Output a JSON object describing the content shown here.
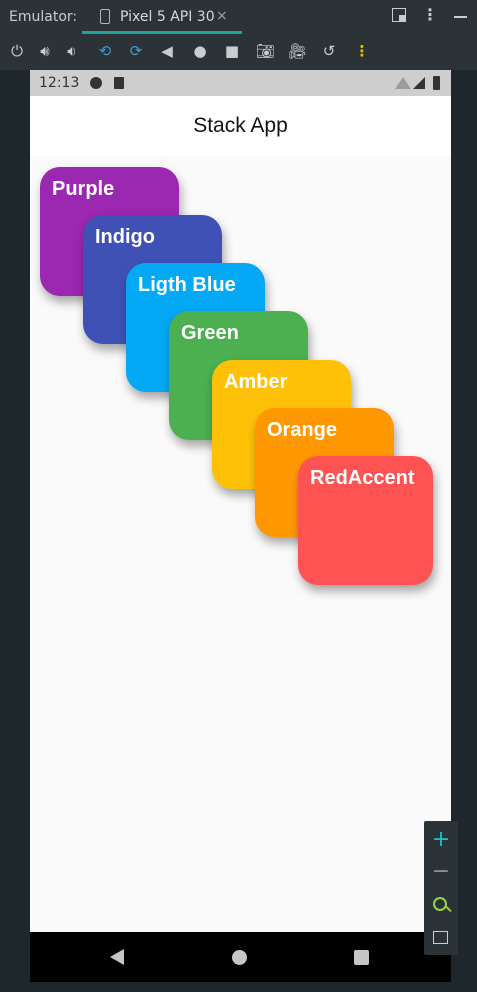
{
  "ide": {
    "label": "Emulator:",
    "device_tab": "Pixel 5 API 30",
    "tab_close_glyph": "×",
    "header_icons": [
      "window-mode-icon",
      "more-vert-icon",
      "minimize-icon"
    ],
    "toolbar_icons": [
      "power-icon",
      "volume-up-icon",
      "volume-down-icon",
      "rotate-left-icon",
      "rotate-right-icon",
      "back-icon",
      "home-icon",
      "overview-icon",
      "screenshot-icon",
      "screen-record-icon",
      "snapshot-icon",
      "more-vert-icon"
    ],
    "accent": "#21a39b"
  },
  "phone": {
    "status_bar": {
      "time": "12:13"
    },
    "app_bar": {
      "title": "Stack App"
    },
    "cards": [
      {
        "label": "Purple",
        "color": "#9c27b0"
      },
      {
        "label": "Indigo",
        "color": "#3f51b5"
      },
      {
        "label": "Ligth Blue",
        "color": "#03a9f4"
      },
      {
        "label": "Green",
        "color": "#4caf50"
      },
      {
        "label": "Amber",
        "color": "#ffc107"
      },
      {
        "label": "Orange",
        "color": "#ff9800"
      },
      {
        "label": "RedAccent",
        "color": "#ff5252"
      }
    ]
  },
  "zoom_controls": {
    "plus_glyph": "+",
    "minus_glyph": "−"
  }
}
